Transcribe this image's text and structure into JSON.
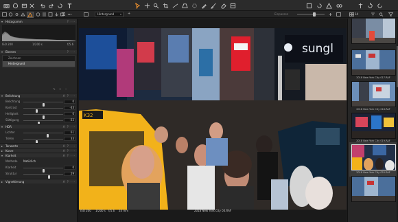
{
  "toolbar": {
    "left_icons": [
      "camera-icon",
      "capture-icon",
      "import-icon",
      "delete-icon",
      "undo-icon",
      "redo-icon",
      "reset-icon",
      "text-icon"
    ],
    "center_icons": [
      "cursor-icon",
      "pan-icon",
      "loupe-icon",
      "crop-icon",
      "straighten-icon",
      "keystone-icon",
      "spot-removal-icon",
      "color-picker-icon",
      "brush-icon",
      "eraser-icon",
      "gradient-icon"
    ],
    "right_icons": [
      "grid-icon",
      "rotate-icon",
      "exposure-warning-icon",
      "focus-mask-icon",
      "compare-icon",
      "proof-icon",
      "process-icon"
    ]
  },
  "subbar": {
    "variant": "Hintergrund",
    "variant_add": "+",
    "right_label": "Einpassen",
    "browser_count": "14"
  },
  "left_panel": {
    "histogram": {
      "title": "Histogramm",
      "iso": "ISO 200",
      "shutter": "1/200 s",
      "aperture": "f/5.6"
    },
    "layers": {
      "title": "Ebenen",
      "items": [
        {
          "label": "Zeichnen",
          "selected": false
        },
        {
          "label": "Hintergrund",
          "selected": true
        }
      ]
    },
    "exposure": {
      "title": "Belichtung",
      "rows": [
        {
          "label": "Belichtung",
          "value": "0",
          "level": 0.5
        },
        {
          "label": "Kontrast",
          "value": "-33",
          "level": 0.34
        },
        {
          "label": "Helligkeit",
          "value": "0",
          "level": 0.5
        },
        {
          "label": "Sättigung",
          "value": "-22",
          "level": 0.39
        }
      ]
    },
    "hdr": {
      "title": "HDR",
      "rows": [
        {
          "label": "Lichter",
          "value": "61",
          "level": 0.61
        },
        {
          "label": "Tiefen",
          "value": "33",
          "level": 0.33
        }
      ]
    },
    "collapsed": [
      {
        "title": "Tonwerte"
      },
      {
        "title": "Kurve"
      }
    ],
    "clarity": {
      "title": "Klarheit",
      "method_label": "Methode",
      "method_value": "Natürlich",
      "rows": [
        {
          "label": "Klarheit",
          "value": "0",
          "level": 0.5
        },
        {
          "label": "Struktur",
          "value": "29",
          "level": 0.64
        }
      ]
    },
    "vignette": {
      "title": "Vignettierung"
    }
  },
  "viewer": {
    "iso": "ISO 200",
    "shutter": "1/200 s",
    "aperture": "f/5.6",
    "focal": "24 mm",
    "filename": "2018 New York City 00.RAF"
  },
  "browser": {
    "thumbs": [
      {
        "name": "",
        "selected": false,
        "scene": "street-tall"
      },
      {
        "name": "2018 New York City 017.RAF",
        "selected": false,
        "scene": "flags"
      },
      {
        "name": "2018 New York City 018.RAF",
        "selected": false,
        "scene": "flags2"
      },
      {
        "name": "2018 New York City 019.RAF",
        "selected": false,
        "scene": "neon"
      },
      {
        "name": "2018 New York City 020.RAF",
        "selected": true,
        "scene": "crowd"
      },
      {
        "name": "",
        "selected": false,
        "scene": "flags"
      }
    ]
  },
  "colors": {
    "accent": "#ff9a2e",
    "panel": "#262626",
    "taxi": "#f2b21a"
  }
}
